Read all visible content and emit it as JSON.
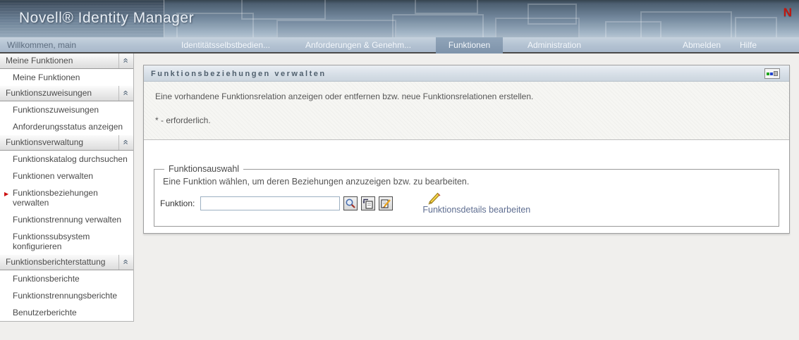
{
  "banner": {
    "title": "Novell® Identity Manager",
    "logo_letter": "N"
  },
  "navbar": {
    "welcome": "Willkommen, main",
    "tabs": [
      {
        "label": "Identitätsselbstbedien...",
        "selected": false
      },
      {
        "label": "Anforderungen & Genehm...",
        "selected": false
      },
      {
        "label": "Funktionen",
        "selected": true
      },
      {
        "label": "Administration",
        "selected": false
      }
    ],
    "right_links": [
      {
        "label": "Abmelden"
      },
      {
        "label": "Hilfe"
      }
    ]
  },
  "sidebar": {
    "sections": [
      {
        "header": "Meine Funktionen",
        "items": [
          {
            "label": "Meine Funktionen",
            "selected": false
          }
        ]
      },
      {
        "header": "Funktionszuweisungen",
        "items": [
          {
            "label": "Funktionszuweisungen",
            "selected": false
          },
          {
            "label": "Anforderungsstatus anzeigen",
            "selected": false
          }
        ]
      },
      {
        "header": "Funktionsverwaltung",
        "items": [
          {
            "label": "Funktionskatalog durchsuchen",
            "selected": false
          },
          {
            "label": "Funktionen verwalten",
            "selected": false
          },
          {
            "label": "Funktionsbeziehungen verwalten",
            "selected": true
          },
          {
            "label": "Funktionstrennung verwalten",
            "selected": false
          },
          {
            "label": "Funktionssubsystem konfigurieren",
            "selected": false
          }
        ]
      },
      {
        "header": "Funktionsberichterstattung",
        "items": [
          {
            "label": "Funktionsberichte",
            "selected": false
          },
          {
            "label": "Funktionstrennungsberichte",
            "selected": false
          },
          {
            "label": "Benutzerberichte",
            "selected": false
          }
        ]
      }
    ]
  },
  "portlet": {
    "title": "Funktionsbeziehungen verwalten",
    "intro": "Eine vorhandene Funktionsrelation anzeigen oder entfernen bzw. neue Funktionsrelationen erstellen.",
    "required_note": "* - erforderlich.",
    "fieldset": {
      "legend": "Funktionsauswahl",
      "description": "Eine Funktion wählen, um deren Beziehungen anzuzeigen bzw. zu bearbeiten.",
      "field_label": "Funktion:",
      "field_value": "",
      "edit_link": "Funktionsdetails bearbeiten"
    }
  },
  "icons": {
    "collapse_glyph": "«",
    "selected_marker": "▶"
  },
  "colors": {
    "brand_red": "#c2170f",
    "selected_tab_bg": "#7e93aa",
    "link_blue": "#5f6e91",
    "marker_red": "#cc1111"
  }
}
